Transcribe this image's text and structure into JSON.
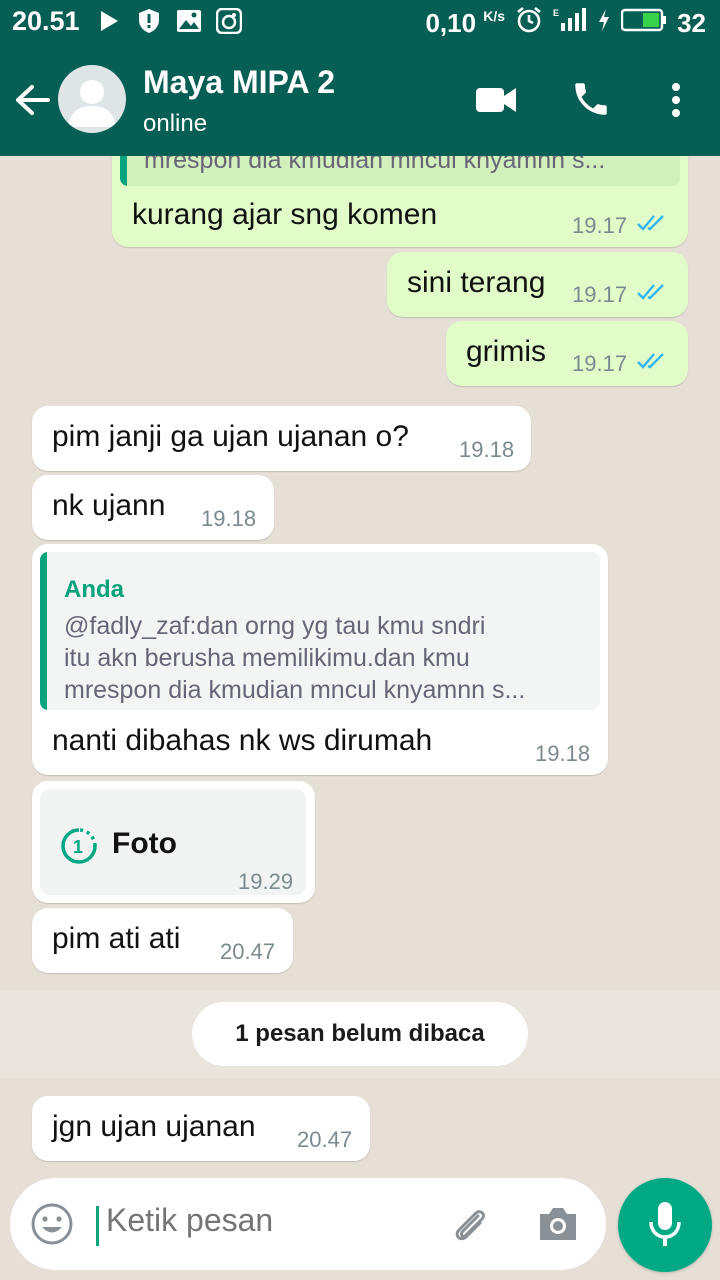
{
  "status_bar": {
    "time": "20.51",
    "net_speed": "0,10",
    "net_unit": "K/s",
    "battery": "32"
  },
  "header": {
    "contact_name": "Maya MIPA 2",
    "contact_status": "online"
  },
  "messages": [
    {
      "dir": "out",
      "quote_text_line": "mrespon dia kmudian mncul knyamnn s...",
      "text": "kurang ajar sng komen",
      "time": "19.17",
      "ticks": "read"
    },
    {
      "dir": "out",
      "text": "sini terang",
      "time": "19.17",
      "ticks": "read"
    },
    {
      "dir": "out",
      "text": "grimis",
      "time": "19.17",
      "ticks": "read"
    },
    {
      "dir": "in",
      "text": "pim janji ga ujan ujanan o?",
      "time": "19.18"
    },
    {
      "dir": "in",
      "text": "nk ujann",
      "time": "19.18"
    },
    {
      "dir": "in",
      "quote_author": "Anda",
      "quote_lines": [
        "@fadly_zaf:dan orng yg tau kmu sndri",
        "itu akn berusha memilikimu.dan kmu",
        "mrespon dia kmudian mncul knyamnn s..."
      ],
      "text": "nanti dibahas nk ws dirumah",
      "time": "19.18"
    },
    {
      "dir": "in",
      "type": "photo",
      "text": "Foto",
      "time": "19.29"
    },
    {
      "dir": "in",
      "text": "pim ati ati",
      "time": "20.47"
    },
    {
      "dir": "in",
      "text": "jgn ujan ujanan",
      "time": "20.47"
    }
  ],
  "unread_label": "1 pesan belum dibaca",
  "input": {
    "placeholder": "Ketik pesan"
  },
  "colors": {
    "header": "#075e54",
    "outgoing_bubble": "#e1fcc9",
    "incoming_bubble": "#ffffff",
    "accent": "#00a884",
    "read_ticks": "#34b7f1"
  },
  "icons": [
    "back-arrow-icon",
    "avatar-placeholder-icon",
    "video-call-icon",
    "phone-icon",
    "more-vert-icon",
    "emoji-icon",
    "attach-icon",
    "camera-icon",
    "mic-icon",
    "view-once-icon",
    "double-check-icon"
  ]
}
